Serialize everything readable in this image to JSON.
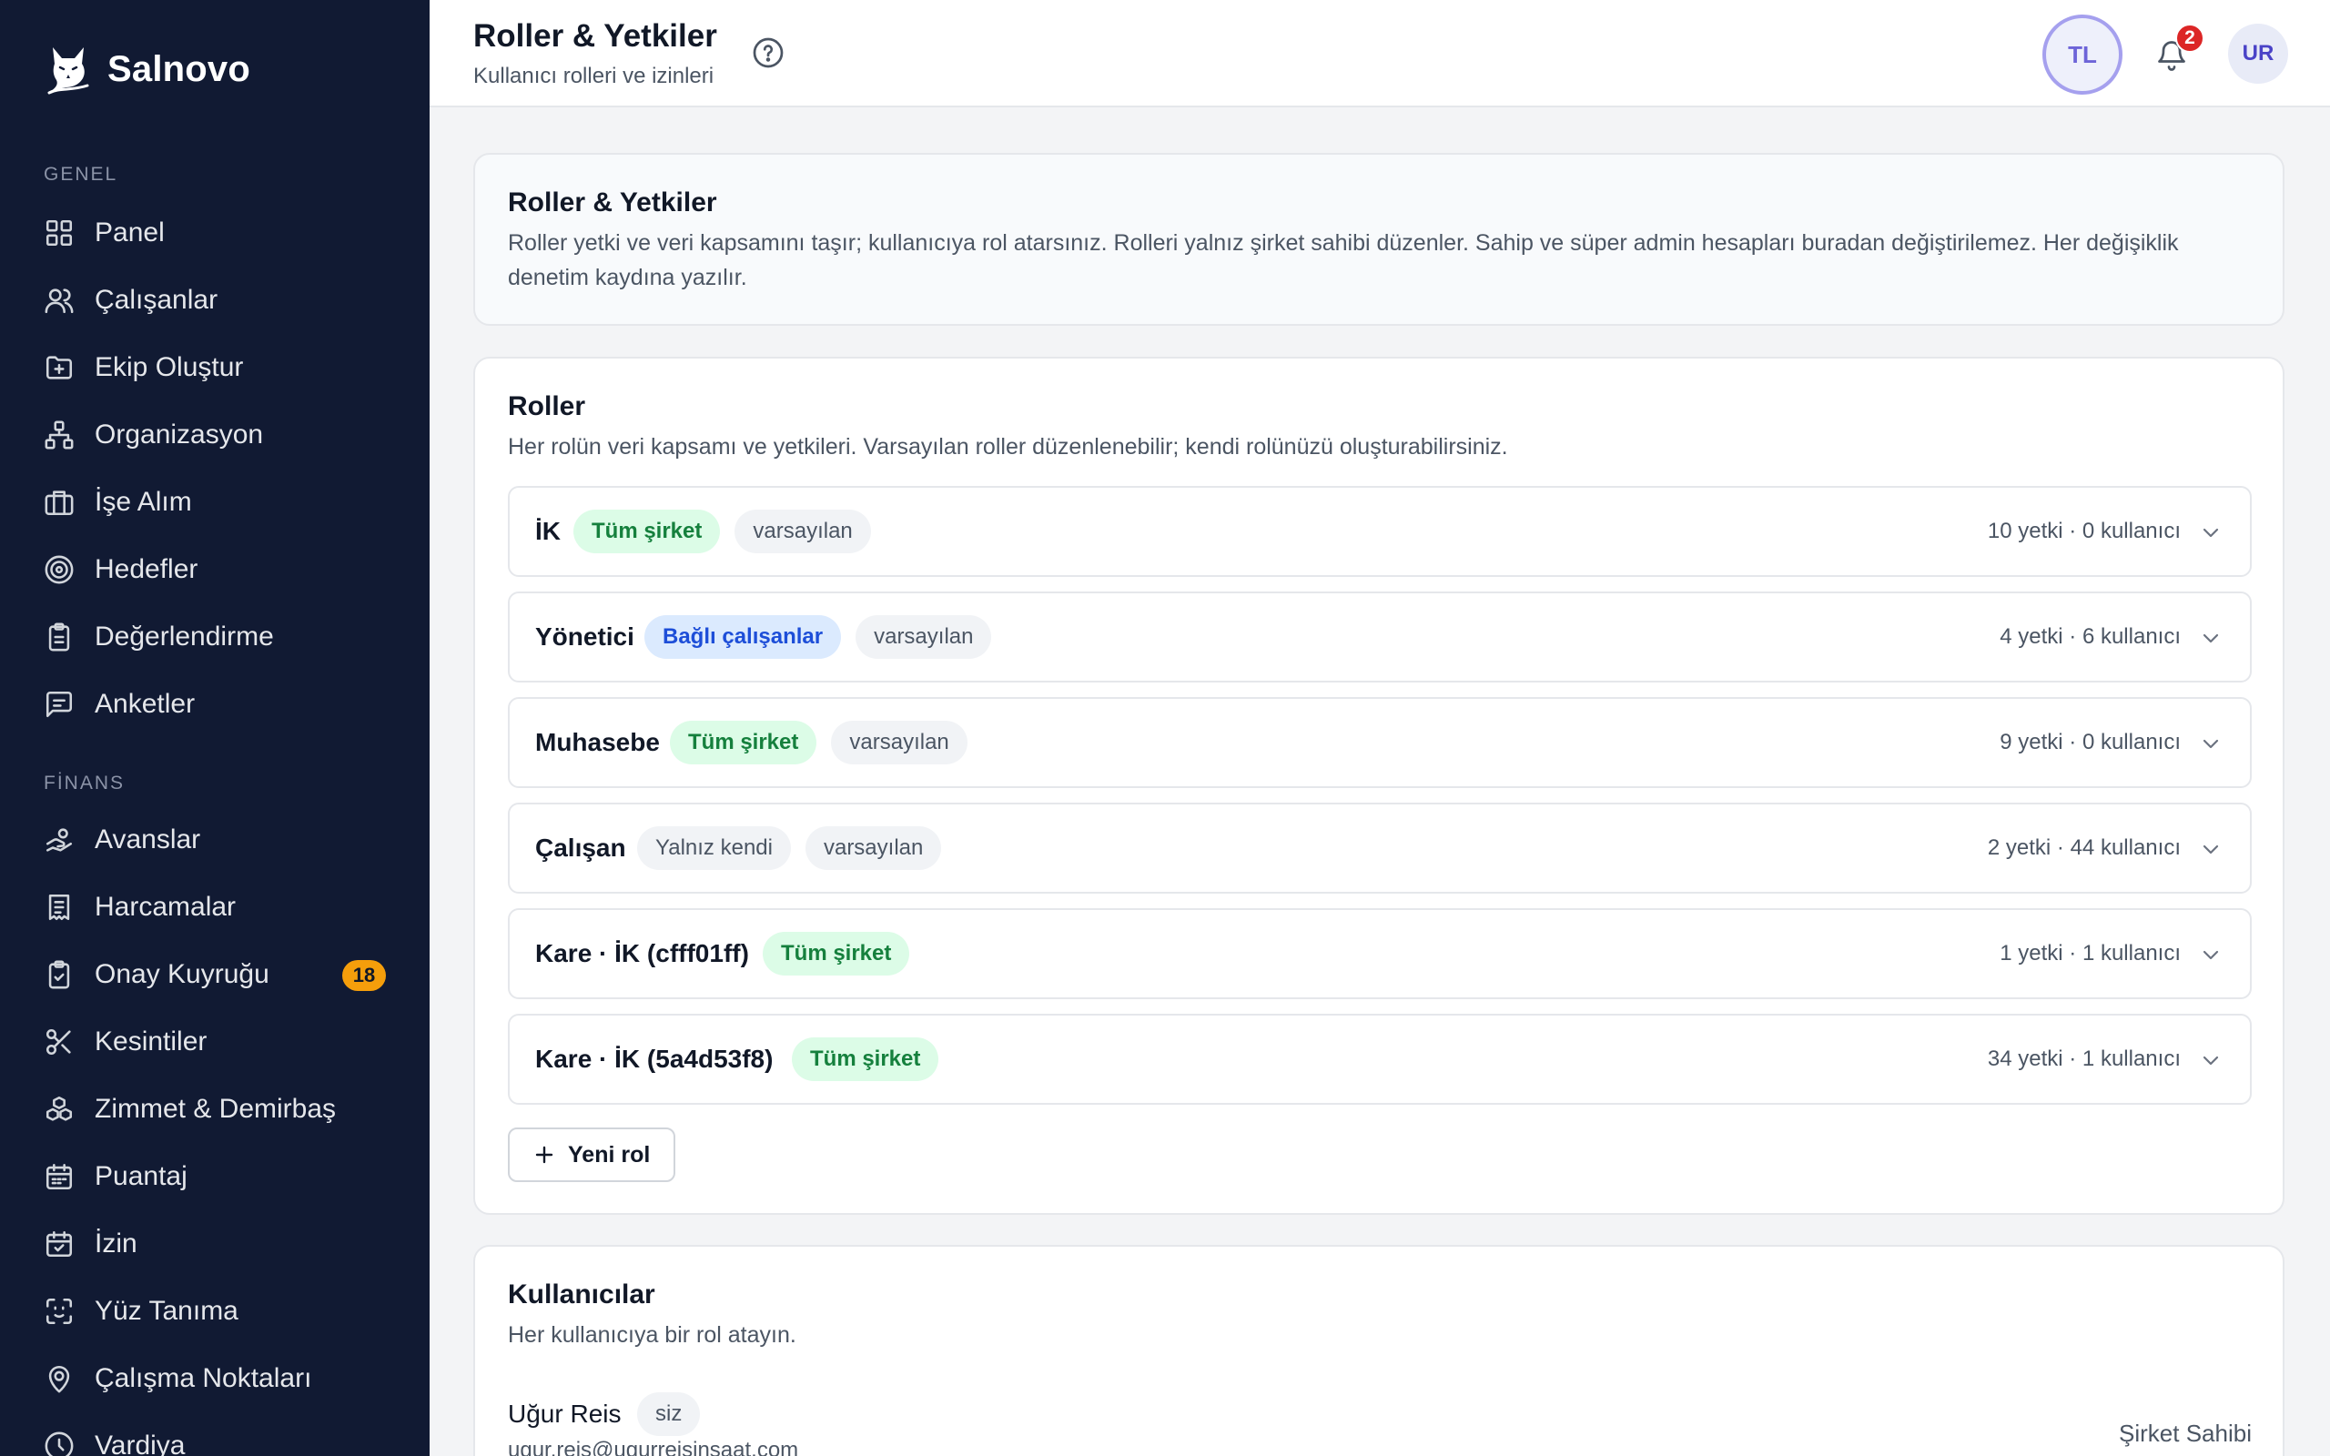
{
  "brand": {
    "name": "Salnovo"
  },
  "sidebar": {
    "sections": [
      {
        "title": "GENEL",
        "items": [
          {
            "label": "Panel",
            "icon": "grid-icon"
          },
          {
            "label": "Çalışanlar",
            "icon": "users-icon"
          },
          {
            "label": "Ekip Oluştur",
            "icon": "folder-plus-icon"
          },
          {
            "label": "Organizasyon",
            "icon": "org-chart-icon"
          },
          {
            "label": "İşe Alım",
            "icon": "briefcase-icon"
          },
          {
            "label": "Hedefler",
            "icon": "target-icon"
          },
          {
            "label": "Değerlendirme",
            "icon": "clipboard-icon"
          },
          {
            "label": "Anketler",
            "icon": "message-icon"
          }
        ]
      },
      {
        "title": "FİNANS",
        "items": [
          {
            "label": "Avanslar",
            "icon": "hand-coins-icon"
          },
          {
            "label": "Harcamalar",
            "icon": "receipt-icon"
          },
          {
            "label": "Onay Kuyruğu",
            "icon": "clipboard-check-icon",
            "badge": "18"
          },
          {
            "label": "Kesintiler",
            "icon": "scissors-icon"
          },
          {
            "label": "Zimmet & Demirbaş",
            "icon": "boxes-icon"
          },
          {
            "label": "Puantaj",
            "icon": "calendar-grid-icon"
          },
          {
            "label": "İzin",
            "icon": "calendar-check-icon"
          },
          {
            "label": "Yüz Tanıma",
            "icon": "face-scan-icon"
          },
          {
            "label": "Çalışma Noktaları",
            "icon": "map-pin-icon"
          },
          {
            "label": "Vardiya",
            "icon": "clock-icon"
          }
        ]
      }
    ]
  },
  "header": {
    "title": "Roller & Yetkiler",
    "subtitle": "Kullanıcı rolleri ve izinleri",
    "avatar_left": "TL",
    "notification_count": "2",
    "avatar_right": "UR"
  },
  "info": {
    "title": "Roller & Yetkiler",
    "text": "Roller yetki ve veri kapsamını taşır; kullanıcıya rol atarsınız. Rolleri yalnız şirket sahibi düzenler. Sahip ve süper admin hesapları buradan değiştirilemez. Her değişiklik denetim kaydına yazılır."
  },
  "roles": {
    "title": "Roller",
    "description": "Her rolün veri kapsamı ve yetkileri. Varsayılan roller düzenlenebilir; kendi rolünüzü oluşturabilirsiniz.",
    "items": [
      {
        "name": "İK",
        "scope": "Tüm şirket",
        "scope_color": "green",
        "default_tag": "varsayılan",
        "stats": "10 yetki · 0 kullanıcı"
      },
      {
        "name": "Yönetici",
        "scope": "Bağlı çalışanlar",
        "scope_color": "blue",
        "default_tag": "varsayılan",
        "stats": "4 yetki · 6 kullanıcı"
      },
      {
        "name": "Muhasebe",
        "scope": "Tüm şirket",
        "scope_color": "green",
        "default_tag": "varsayılan",
        "stats": "9 yetki · 0 kullanıcı"
      },
      {
        "name": "Çalışan",
        "scope": "Yalnız kendi",
        "scope_color": "gray",
        "default_tag": "varsayılan",
        "stats": "2 yetki · 44 kullanıcı"
      },
      {
        "name": "Kare · İK (cfff01ff)",
        "scope": "Tüm şirket",
        "scope_color": "green",
        "default_tag": "",
        "stats": "1 yetki · 1 kullanıcı"
      },
      {
        "name": "Kare · İK (5a4d53f8)",
        "scope": "Tüm şirket",
        "scope_color": "green",
        "default_tag": "",
        "stats": "34 yetki · 1 kullanıcı"
      }
    ],
    "new_role_label": "Yeni rol"
  },
  "users": {
    "title": "Kullanıcılar",
    "description": "Her kullanıcıya bir rol atayın.",
    "items": [
      {
        "name": "Uğur Reis",
        "tag": "siz",
        "email": "ugur.reis@ugurreisinsaat.com",
        "role": "Şirket Sahibi"
      }
    ]
  }
}
